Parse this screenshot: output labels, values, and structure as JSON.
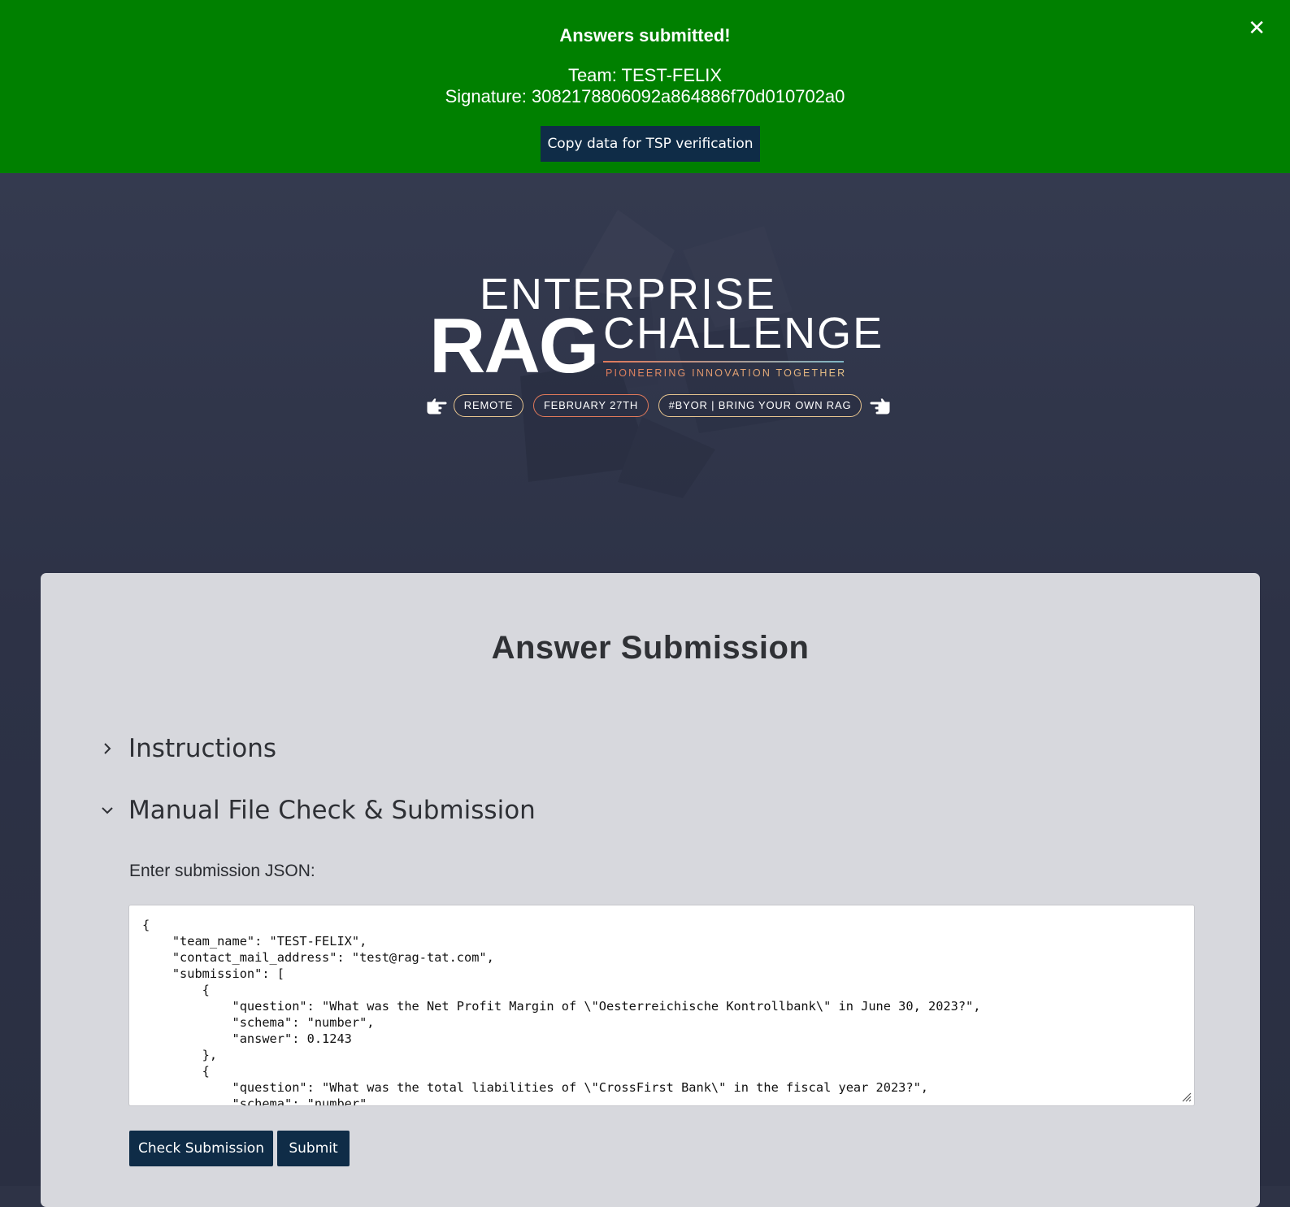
{
  "banner": {
    "title": "Answers submitted!",
    "team_line": "Team: TEST-FELIX",
    "signature_line": "Signature: 3082178806092a864886f70d010702a0",
    "copy_button": "Copy data for TSP verification",
    "close_icon": "close-icon",
    "close_glyph": "✕",
    "background_color": "#008000"
  },
  "hero": {
    "logo": {
      "line1": "ENTERPRISE",
      "line2_bold": "RAG",
      "line2_light": "CHALLENGE",
      "tagline": "PIONEERING INNOVATION TOGETHER"
    },
    "pills": [
      "REMOTE",
      "FEBRUARY 27TH",
      "#BYOR | BRING YOUR OWN RAG"
    ],
    "icons": [
      "hand-pointing-right-icon",
      "hand-pointing-left-icon"
    ]
  },
  "card": {
    "title": "Answer Submission",
    "sections": [
      {
        "label": "Instructions",
        "expanded": false,
        "icon": "chevron-right-icon"
      },
      {
        "label": "Manual File Check & Submission",
        "expanded": true,
        "icon": "chevron-down-icon"
      }
    ],
    "json_label": "Enter submission JSON:",
    "json_value": "{\n    \"team_name\": \"TEST-FELIX\",\n    \"contact_mail_address\": \"test@rag-tat.com\",\n    \"submission\": [\n        {\n            \"question\": \"What was the Net Profit Margin of \\\"Oesterreichische Kontrollbank\\\" in June 30, 2023?\",\n            \"schema\": \"number\",\n            \"answer\": 0.1243\n        },\n        {\n            \"question\": \"What was the total liabilities of \\\"CrossFirst Bank\\\" in the fiscal year 2023?\",\n            \"schema\": \"number\",",
    "buttons": {
      "check": "Check Submission",
      "submit": "Submit"
    }
  },
  "colors": {
    "primary_button": "#0f2c47",
    "page_background": "#2e3346",
    "card_background": "#d7d8dd"
  }
}
